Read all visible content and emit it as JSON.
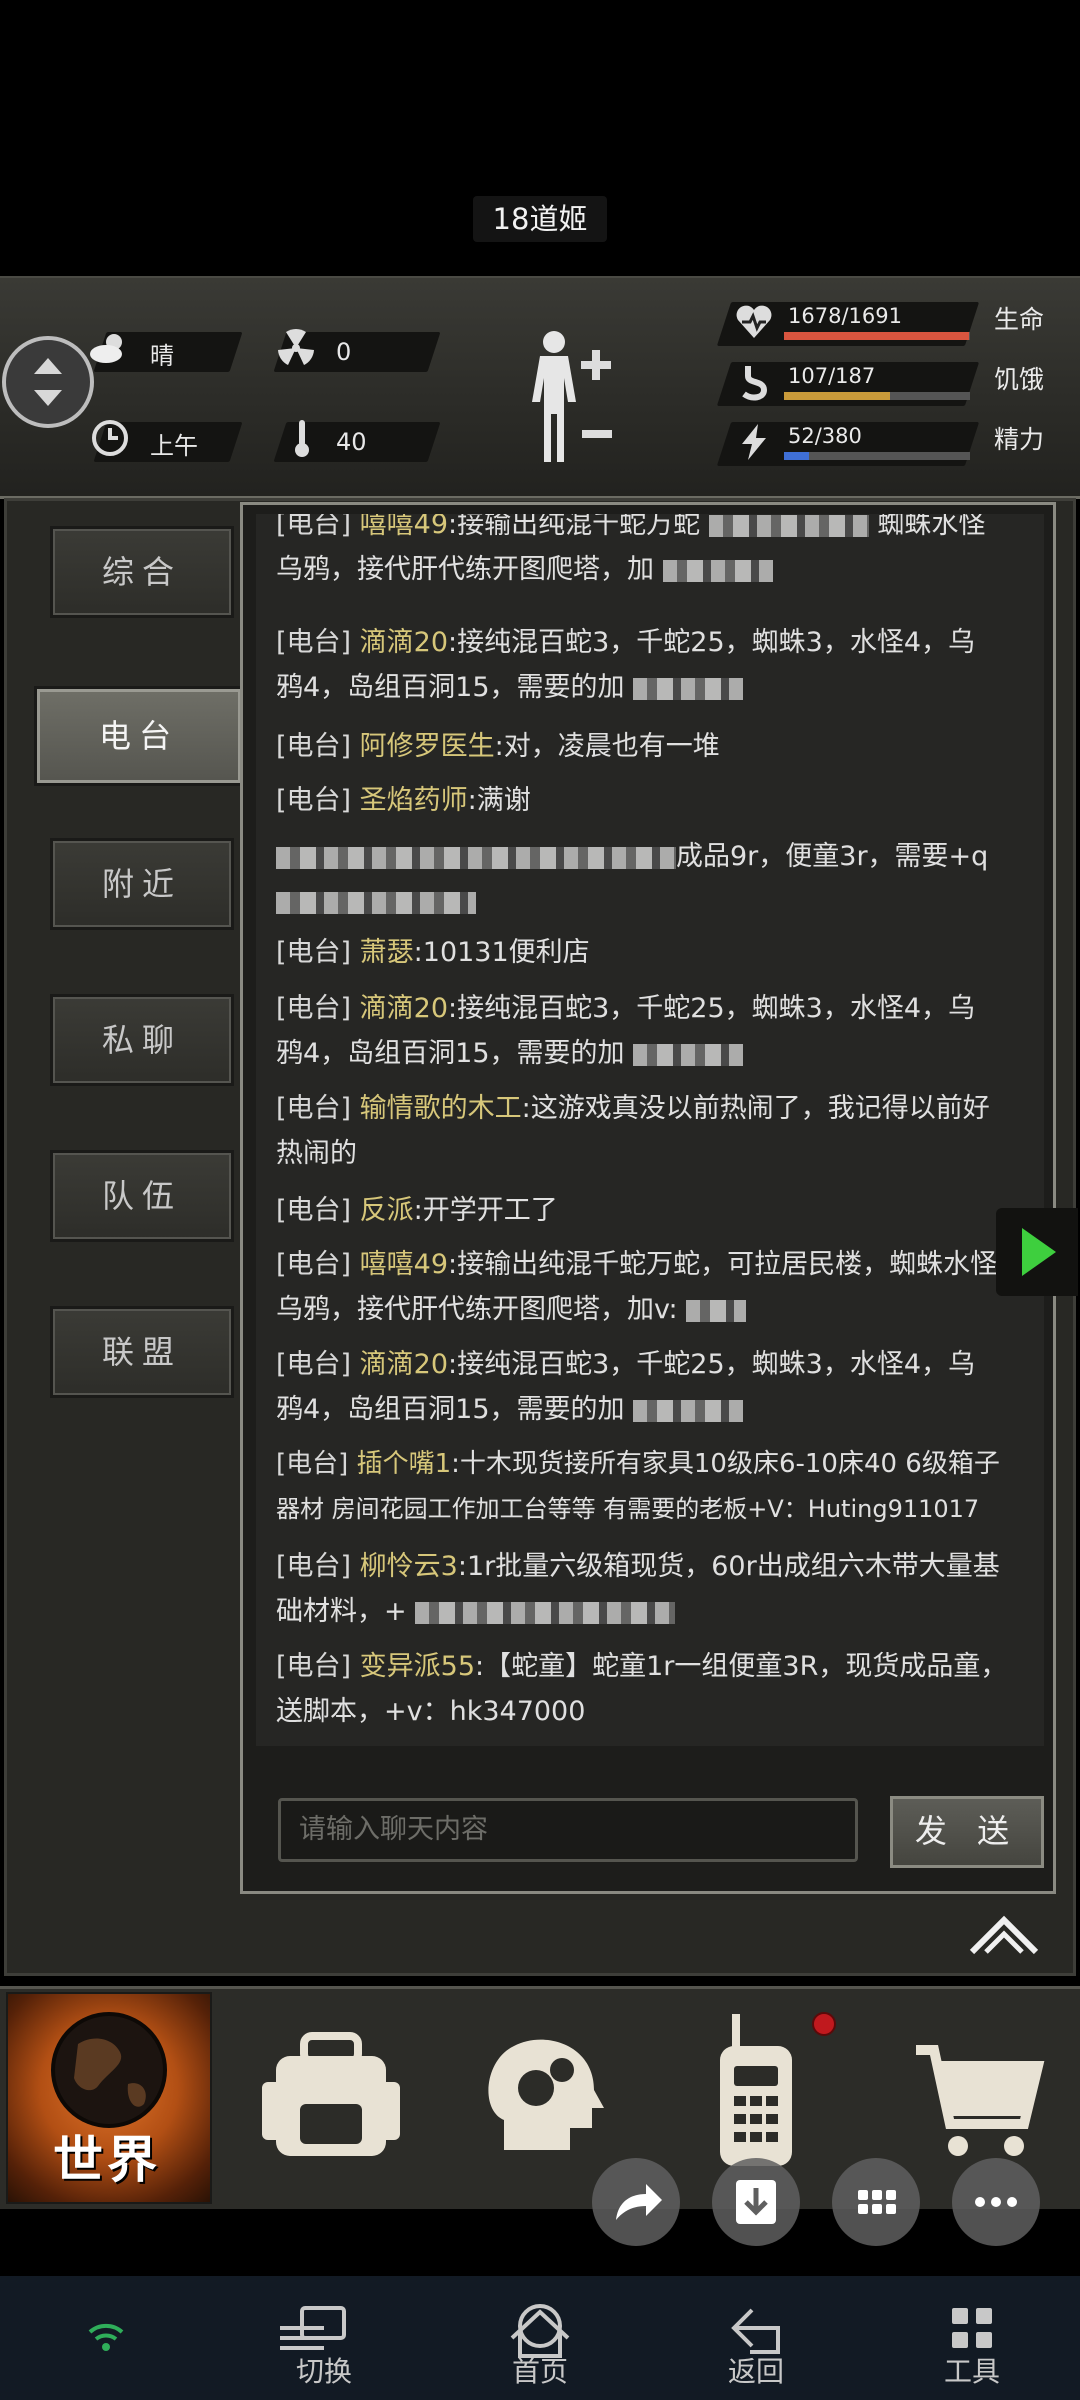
{
  "title": "18道姬",
  "status": {
    "weather": "晴",
    "radiation": "0",
    "time_of_day": "上午",
    "temperature": "40",
    "health": {
      "value": "1678/1691",
      "label": "生命",
      "fraction": 0.992,
      "color": "#d8553f"
    },
    "hunger": {
      "value": "107/187",
      "label": "饥饿",
      "fraction": 0.572,
      "color": "#c99a3a"
    },
    "energy": {
      "value": "52/380",
      "label": "精力",
      "fraction": 0.137,
      "color": "#3f6fd6"
    }
  },
  "tabs": [
    {
      "label": "综合",
      "active": false
    },
    {
      "label": "电台",
      "active": true
    },
    {
      "label": "附近",
      "active": false
    },
    {
      "label": "私聊",
      "active": false
    },
    {
      "label": "队伍",
      "active": false
    },
    {
      "label": "联盟",
      "active": false
    }
  ],
  "messages": [
    {
      "channel": "[电台]",
      "name": "嘻嘻49",
      "text": ":接输出纯混千蛇万蛇",
      "text2": "蜘蛛水怪",
      "line2": "乌鸦，接代肝代练开图爬塔，加"
    },
    {
      "channel": "[电台]",
      "name": "滴滴20",
      "text": ":接纯混百蛇3，千蛇25，蜘蛛3，水怪4，乌",
      "line2": "鸦4，岛组百洞15，需要的加"
    },
    {
      "channel": "[电台]",
      "name": "阿修罗医生",
      "text": ":对，凌晨也有一堆"
    },
    {
      "channel": "[电台]",
      "name": "圣焰药师",
      "text": ":满谢"
    },
    {
      "channel": "[电台]",
      "name": "",
      "text": "成品9r，便童3r，需要+q"
    },
    {
      "channel": "[电台]",
      "name": "萧瑟",
      "text": ":10131便利店"
    },
    {
      "channel": "[电台]",
      "name": "滴滴20",
      "text": ":接纯混百蛇3，千蛇25，蜘蛛3，水怪4，乌",
      "line2": "鸦4，岛组百洞15，需要的加"
    },
    {
      "channel": "[电台]",
      "name": "输情歌的木工",
      "text": ":这游戏真没以前热闹了，我记得以前好",
      "line2": "热闹的"
    },
    {
      "channel": "[电台]",
      "name": "反派",
      "text": ":开学开工了"
    },
    {
      "channel": "[电台]",
      "name": "嘻嘻49",
      "text": ":接输出纯混千蛇万蛇，可拉居民楼，蜘蛛水怪",
      "line2": "乌鸦，接代肝代练开图爬塔，加v:"
    },
    {
      "channel": "[电台]",
      "name": "滴滴20",
      "text": ":接纯混百蛇3，千蛇25，蜘蛛3，水怪4，乌",
      "line2": "鸦4，岛组百洞15，需要的加"
    },
    {
      "channel": "[电台]",
      "name": "插个嘴1",
      "text": ":十木现货接所有家具10级床6-10床40 6级箱子",
      "line2": "器材 房间花园工作加工台等等 有需要的老板+V：Huting911017"
    },
    {
      "channel": "[电台]",
      "name": "柳怜云3",
      "text": ":1r批量六级箱现货，60r出成组六木带大量基",
      "line2": "础材料，+"
    },
    {
      "channel": "[电台]",
      "name": "变异派55",
      "text": ":【蛇童】蛇童1r一组便童3R，现货成品童，",
      "line2": "送脚本，+v：hk347000"
    }
  ],
  "input": {
    "placeholder": "请输入聊天内容"
  },
  "send_label": "发 送",
  "bottom_bar": {
    "world_label": "世界",
    "tools": [
      "backpack-icon",
      "skills-head-icon",
      "radio-icon",
      "shop-cart-icon"
    ]
  },
  "system_nav": [
    "切换",
    "首页",
    "返回",
    "工具"
  ]
}
